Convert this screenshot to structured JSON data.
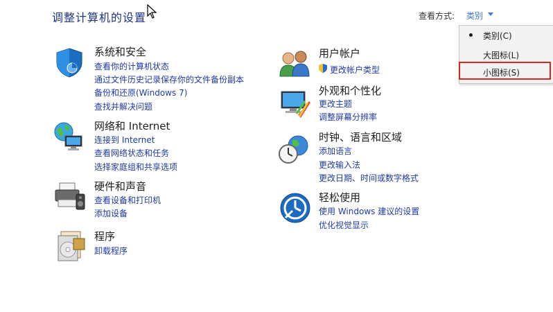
{
  "header": {
    "title": "调整计算机的设置",
    "view_by_label": "查看方式:",
    "view_by_value": "类别"
  },
  "dropdown": {
    "items": [
      {
        "label": "类别(C)",
        "selected": true
      },
      {
        "label": "大图标(L)",
        "selected": false
      },
      {
        "label": "小图标(S)",
        "selected": false
      }
    ]
  },
  "categories": {
    "system_security": {
      "title": "系统和安全",
      "links": [
        "查看你的计算机状态",
        "通过文件历史记录保存你的文件备份副本",
        "备份和还原(Windows 7)",
        "查找并解决问题"
      ]
    },
    "network": {
      "title": "网络和 Internet",
      "links": [
        "连接到 Internet",
        "查看网络状态和任务",
        "选择家庭组和共享选项"
      ]
    },
    "hardware": {
      "title": "硬件和声音",
      "links": [
        "查看设备和打印机",
        "添加设备"
      ]
    },
    "programs": {
      "title": "程序",
      "links": [
        "卸载程序"
      ]
    },
    "user_accounts": {
      "title": "用户帐户",
      "links": [
        "更改帐户类型"
      ]
    },
    "appearance": {
      "title": "外观和个性化",
      "links": [
        "更改主题",
        "调整屏幕分辨率"
      ]
    },
    "clock_region": {
      "title": "时钟、语言和区域",
      "links": [
        "添加语言",
        "更改输入法",
        "更改日期、时间或数字格式"
      ]
    },
    "ease_of_access": {
      "title": "轻松使用",
      "links": [
        "使用 Windows 建议的设置",
        "优化视觉显示"
      ]
    }
  },
  "colors": {
    "title": "#1e3287",
    "link": "#1e3aa8",
    "highlight_border": "#d9261c"
  }
}
